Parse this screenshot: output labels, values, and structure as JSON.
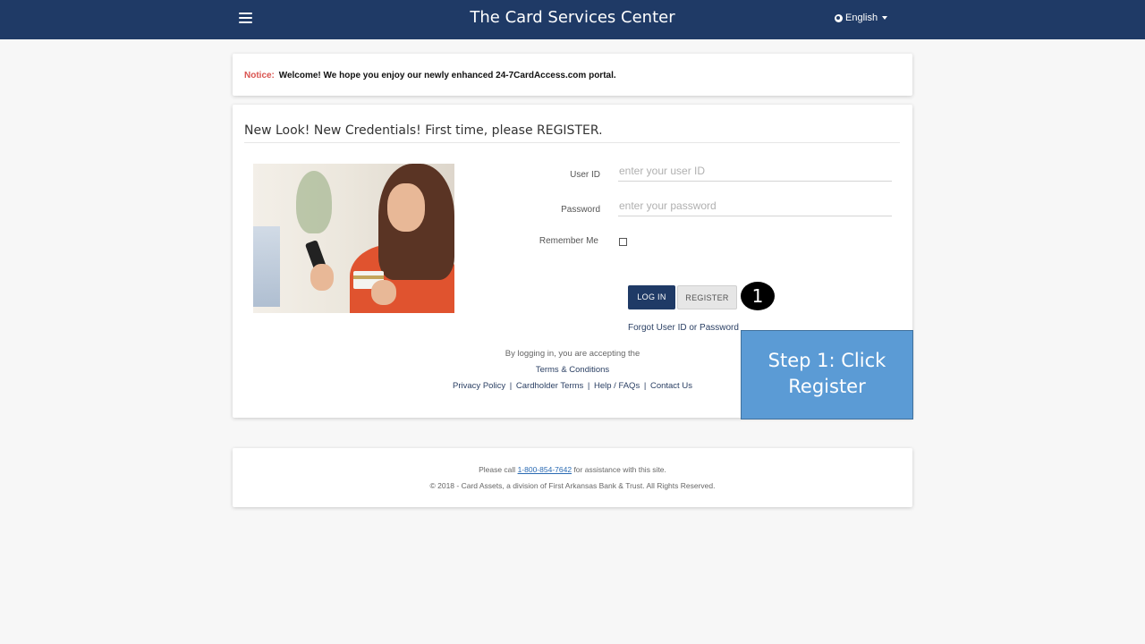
{
  "header": {
    "title": "The Card Services Center",
    "language": "English"
  },
  "notice": {
    "label": "Notice:",
    "message": "Welcome! We hope you enjoy our newly enhanced 24-7CardAccess.com portal."
  },
  "login": {
    "heading": "New Look! New Credentials! First time, please REGISTER.",
    "user_id_label": "User ID",
    "user_id_placeholder": "enter your user ID",
    "password_label": "Password",
    "password_placeholder": "enter your password",
    "remember_label": "Remember Me",
    "login_button": "LOG IN",
    "register_button": "REGISTER",
    "forgot_link": "Forgot User ID or Password",
    "accept_text": "By logging in, you are accepting the",
    "terms_link": "Terms & Conditions",
    "links": {
      "privacy": "Privacy Policy",
      "cardholder": "Cardholder Terms",
      "help": "Help / FAQs",
      "contact": "Contact Us",
      "separator": "|"
    }
  },
  "annotation": {
    "step_number": "1",
    "callout_line1": "Step 1: Click",
    "callout_line2": "Register",
    "callout_color": "#5b9bd5"
  },
  "footer": {
    "call_prefix": "Please call",
    "phone": "1-800-854-7642",
    "call_suffix": "for assistance with this site.",
    "copyright": "© 2018 - Card Assets, a division of First Arkansas Bank & Trust. All Rights Reserved."
  },
  "colors": {
    "navbar": "#1f3a66",
    "notice_label": "#d9534f",
    "page_bg": "#f7f7f7"
  },
  "icons": {
    "menu": "hamburger-icon",
    "language": "globe-icon",
    "dropdown": "caret-down-icon"
  }
}
